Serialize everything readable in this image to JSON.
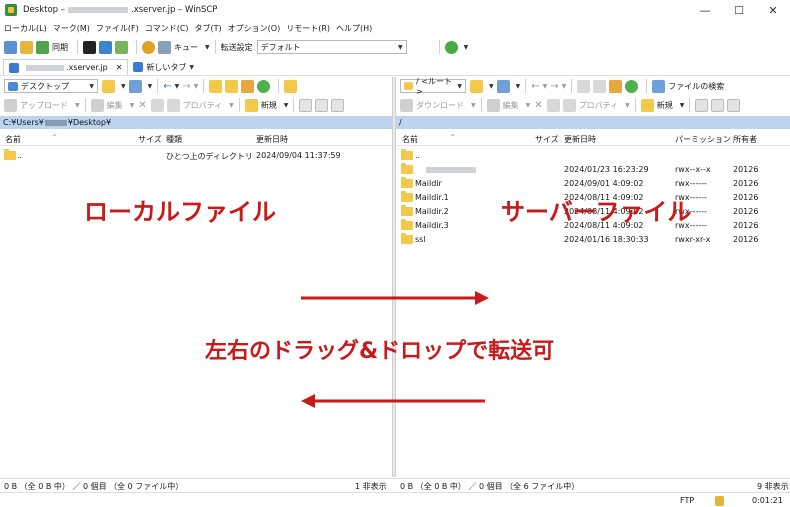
{
  "window": {
    "title_prefix": "Desktop –",
    "title_suffix": ".xserver.jp – WinSCP",
    "minimize": "—",
    "maximize": "☐",
    "close": "✕"
  },
  "menu": [
    "ローカル(L)",
    "マーク(M)",
    "ファイル(F)",
    "コマンド(C)",
    "タブ(T)",
    "オプション(O)",
    "リモート(R)",
    "ヘルプ(H)"
  ],
  "toolbar": {
    "sync_label": "同期",
    "queue_label": "キュー",
    "transfer_settings_label": "転送設定",
    "transfer_settings_value": "デフォルト"
  },
  "tabs": {
    "session_suffix": ".xserver.jp",
    "close": "✕",
    "new_tab": "新しいタブ"
  },
  "left": {
    "drive": "デスクトップ",
    "upload": "アップロード",
    "edit": "編集",
    "properties": "プロパティ",
    "new": "新規",
    "path_prefix": "C:¥Users¥",
    "path_suffix": "¥Desktop¥",
    "columns": {
      "name": "名前",
      "size": "サイズ",
      "type": "種類",
      "modified": "更新日時"
    },
    "rows": [
      {
        "name": "..",
        "type": "ひとつ上のディレクトリ",
        "modified": "2024/09/04 11:37:59"
      }
    ],
    "status": "0 B （全 0 B 中） ／ 0 個目 （全 0 ファイル中）",
    "hidden": "1 非表示"
  },
  "right": {
    "folder": "/ <ルート>",
    "find_files": "ファイルの検索",
    "download": "ダウンロード",
    "edit": "編集",
    "properties": "プロパティ",
    "new": "新規",
    "path": "/",
    "columns": {
      "name": "名前",
      "size": "サイズ",
      "modified": "更新日時",
      "permissions": "パーミッション",
      "owner": "所有者"
    },
    "rows": [
      {
        "name": "..",
        "modified": "",
        "perm": "",
        "owner": ""
      },
      {
        "name": "",
        "modified": "2024/01/23 16:23:29",
        "perm": "rwx--x--x",
        "owner": "20126"
      },
      {
        "name": "Maildir",
        "modified": "2024/09/01 4:09:02",
        "perm": "rwx------",
        "owner": "20126"
      },
      {
        "name": "Maildir.1",
        "modified": "2024/08/11 4:09:02",
        "perm": "rwx------",
        "owner": "20126"
      },
      {
        "name": "Maildir.2",
        "modified": "2024/08/11 4:09:02",
        "perm": "rwx------",
        "owner": "20126"
      },
      {
        "name": "Maildir.3",
        "modified": "2024/08/11 4:09:02",
        "perm": "rwx------",
        "owner": "20126"
      },
      {
        "name": "ssl",
        "modified": "2024/01/16 18:30:33",
        "perm": "rwxr-xr-x",
        "owner": "20126"
      }
    ],
    "status": "0 B （全 0 B 中） ／ 0 個目 （全 6 ファイル中）",
    "hidden": "9 非表示"
  },
  "statusbar": {
    "protocol": "FTP",
    "time": "0:01:21"
  },
  "annotations": {
    "local": "ローカルファイル",
    "server": "サーバーファイル",
    "dnd": "左右のドラッグ&ドロップで転送可",
    "color": "#c81a1a"
  }
}
